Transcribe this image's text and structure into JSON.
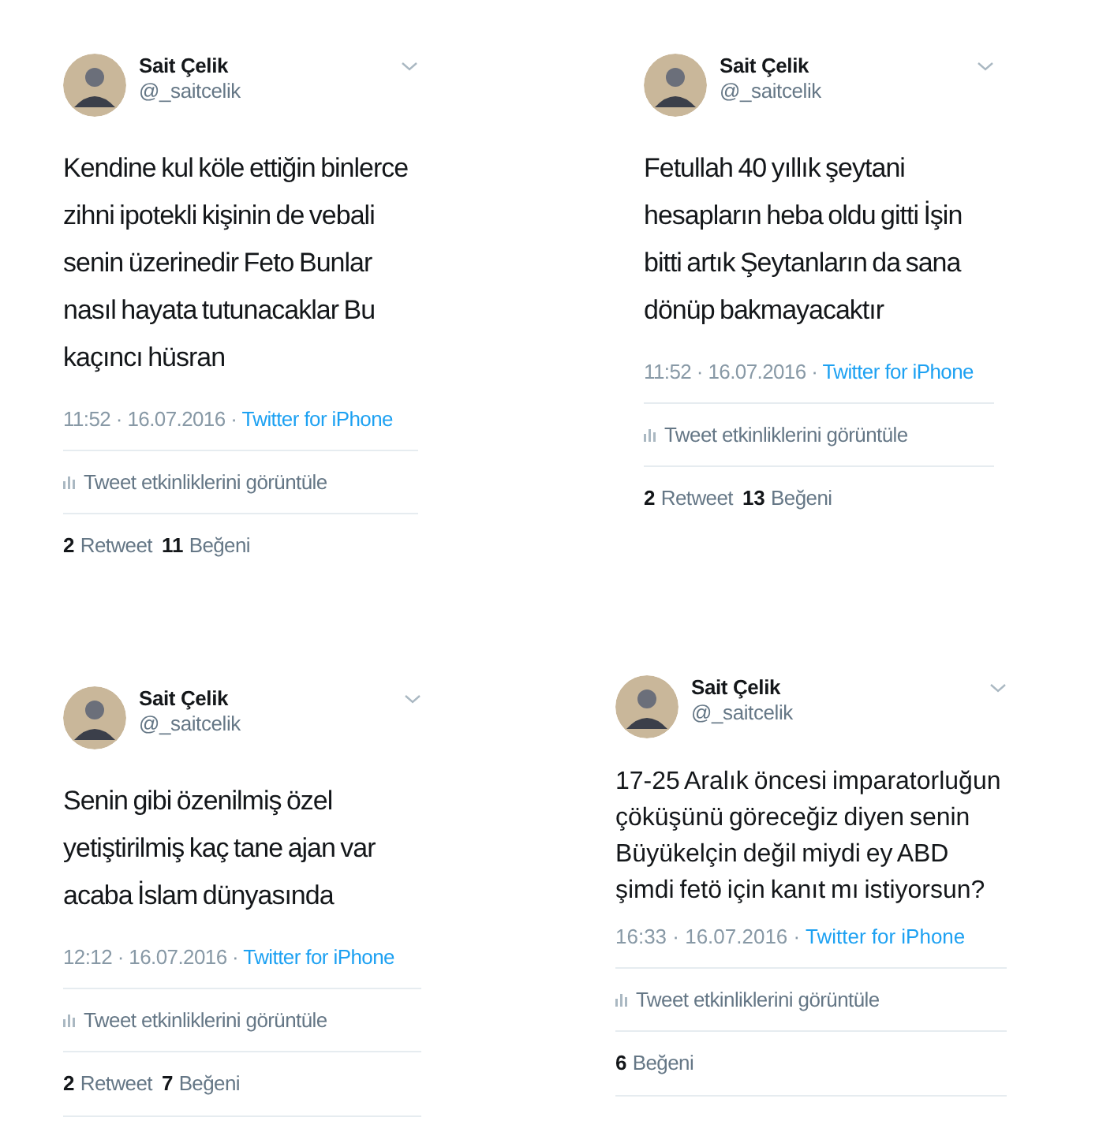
{
  "tweets": [
    {
      "name": "Sait Çelik",
      "handle": "@_saitcelik",
      "text": "Kendine kul köle ettiğin binlerce zihni ipotekli kişinin de vebali senin üzerinedir Feto Bunlar nasıl hayata tutunacaklar Bu kaçıncı hüsran",
      "time": "11:52 · 16.07.2016 ·",
      "source": "Twitter for iPhone",
      "analytics": "Tweet etkinliklerini görüntüle",
      "stats": [
        {
          "count": "2",
          "label": "Retweet"
        },
        {
          "count": "11",
          "label": "Beğeni"
        }
      ],
      "bottom_rule": false
    },
    {
      "name": "Sait Çelik",
      "handle": "@_saitcelik",
      "text": "Fetullah 40 yıllık şeytani hesapların heba oldu gitti İşin bitti artık Şeytanların da sana dönüp bakmayacaktır",
      "time": "11:52 · 16.07.2016 ·",
      "source": "Twitter for iPhone",
      "analytics": "Tweet etkinliklerini görüntüle",
      "stats": [
        {
          "count": "2",
          "label": "Retweet"
        },
        {
          "count": "13",
          "label": "Beğeni"
        }
      ],
      "bottom_rule": false
    },
    {
      "name": "Sait Çelik",
      "handle": "@_saitcelik",
      "text": "Senin gibi özenilmiş özel yetiştirilmiş kaç tane ajan var acaba İslam dünyasında",
      "time": "12:12 · 16.07.2016 ·",
      "source": "Twitter for iPhone",
      "analytics": "Tweet etkinliklerini görüntüle",
      "stats": [
        {
          "count": "2",
          "label": "Retweet"
        },
        {
          "count": "7",
          "label": "Beğeni"
        }
      ],
      "bottom_rule": true
    },
    {
      "name": "Sait Çelik",
      "handle": "@_saitcelik",
      "text": "17-25 Aralık öncesi imparatorluğun çöküşünü göreceğiz diyen senin Büyükelçin değil miydi ey ABD şimdi fetö için kanıt mı istiyorsun?",
      "time": "16:33 · 16.07.2016 ·",
      "source": "Twitter for iPhone",
      "analytics": "Tweet etkinliklerini görüntüle",
      "stats": [
        {
          "count": "6",
          "label": "Beğeni"
        }
      ],
      "bottom_rule": true
    }
  ]
}
